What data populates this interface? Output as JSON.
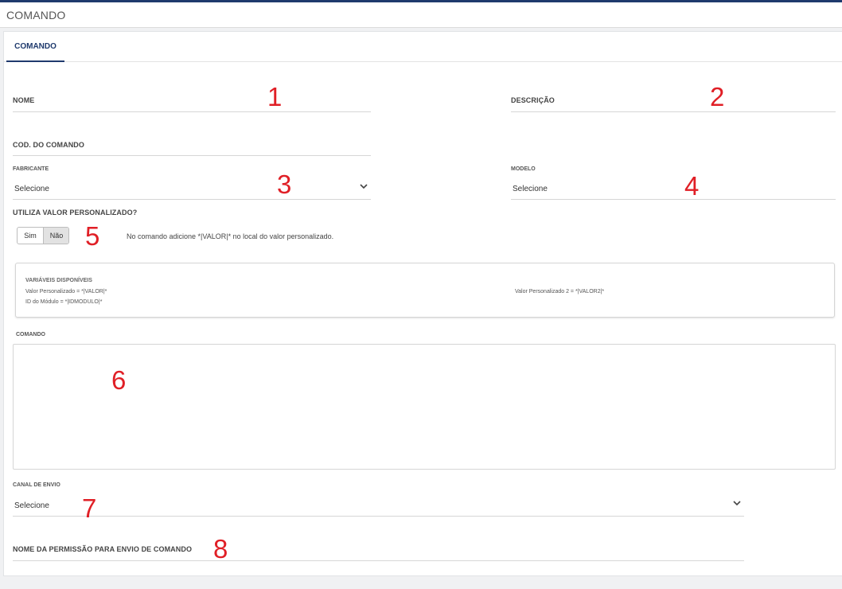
{
  "header": {
    "title": "COMANDO"
  },
  "tabs": [
    {
      "label": "COMANDO",
      "active": true
    }
  ],
  "form": {
    "nome": {
      "label": "NOME",
      "value": ""
    },
    "descricao": {
      "label": "DESCRIÇÃO",
      "value": ""
    },
    "cod_comando": {
      "label": "COD. DO COMANDO",
      "value": ""
    },
    "fabricante": {
      "label": "FABRICANTE",
      "selected": "Selecione"
    },
    "modelo": {
      "label": "MODELO",
      "selected": "Selecione"
    },
    "valor_personalizado": {
      "label": "UTILIZA VALOR PERSONALIZADO?",
      "options": [
        "Sim",
        "Não"
      ],
      "selected": "Não",
      "hint": "No comando adicione *|VALOR|* no local do valor personalizado."
    },
    "variaveis": {
      "title": "VARIÁVEIS DISPONÍVEIS",
      "items": [
        "Valor Personalizado = *|VALOR|*",
        "Valor Personalizado 2 = *|VALOR2|*",
        "ID do Módulo = *|IDMODULO|*"
      ]
    },
    "comando": {
      "label": "COMANDO",
      "value": ""
    },
    "canal_envio": {
      "label": "CANAL DE ENVIO",
      "selected": "Selecione"
    },
    "nome_permissao": {
      "label": "NOME DA PERMISSÃO PARA ENVIO DE COMANDO",
      "value": ""
    }
  },
  "annotations": [
    "1",
    "2",
    "3",
    "4",
    "5",
    "6",
    "7",
    "8"
  ],
  "colors": {
    "accent": "#1f3a6d",
    "annotation": "#e01f26"
  },
  "icons": {
    "select_chevron": "chevron-down-icon"
  }
}
